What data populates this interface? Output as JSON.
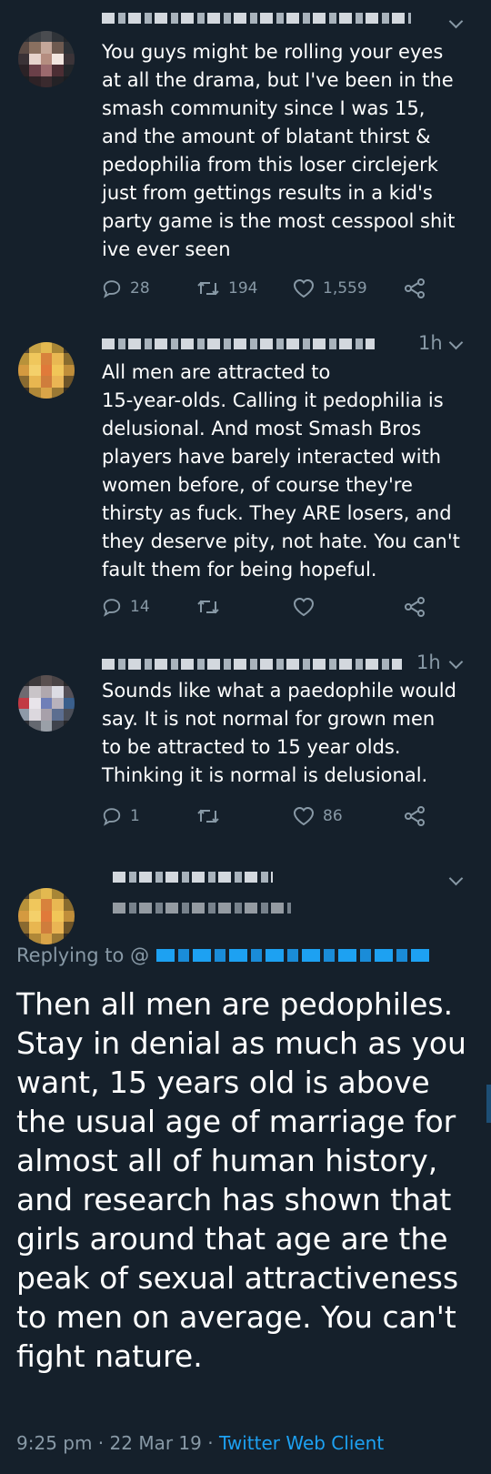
{
  "tweets": [
    {
      "time": "",
      "text": "You guys might be rolling your eyes\nat all the drama, but I've been in the\nsmash community since I was 15,\nand the amount of blatant thirst &\npedophilia from this loser circlejerk\njust from gettings results in a kid's\nparty game is the most cesspool shit\nive ever seen",
      "replies": "28",
      "retweets": "194",
      "likes": "1,559"
    },
    {
      "time": "1h",
      "text": "All men are attracted to\n15-year-olds. Calling it pedophilia is\ndelusional. And most Smash Bros\nplayers have barely interacted with\nwomen before, of course they're\nthirsty as fuck. They ARE losers, and\nthey deserve pity, not hate. You can't\nfault them for being hopeful.",
      "replies": "14",
      "retweets": "",
      "likes": ""
    },
    {
      "time": "1h",
      "text": "Sounds like what a paedophile would\nsay. It is not normal for grown men\nto be attracted to 15 year olds.\nThinking it is normal is delusional.",
      "replies": "1",
      "retweets": "",
      "likes": "86"
    }
  ],
  "focused": {
    "replying_to": "Replying to @",
    "text": "Then all men are pedophiles. Stay in denial as much as you want, 15 years old is above the usual age of marriage for almost all of human history, and research has shown that girls around that age are the peak of sexual attractiveness to men on average. You can't fight nature.",
    "timestamp": "9:25 pm · 22 Mar 19 · ",
    "client": "Twitter Web Client"
  },
  "icons": {
    "reply": "reply-icon",
    "retweet": "retweet-icon",
    "like": "heart-icon",
    "share": "share-icon",
    "more": "chevron-down-icon"
  },
  "colors": {
    "background": "#15202b",
    "text": "#ffffff",
    "muted": "#8899a6",
    "link": "#1da1f2"
  }
}
